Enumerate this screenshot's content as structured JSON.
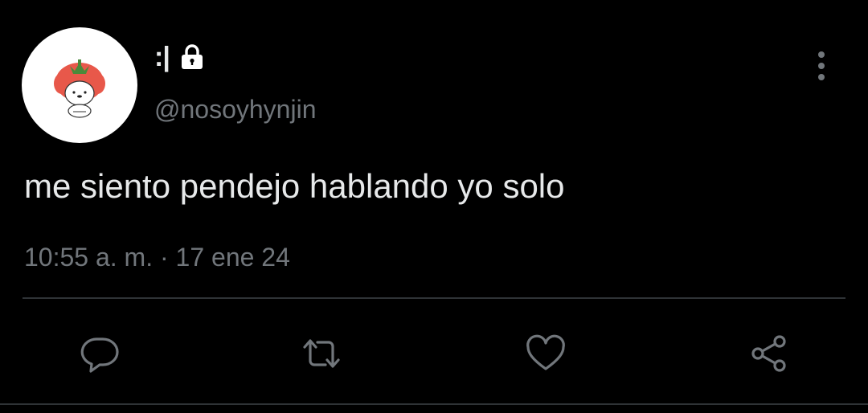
{
  "tweet": {
    "display_name": ":|",
    "handle": "@nosoyhynjin",
    "text": "me siento pendejo hablando yo solo",
    "time": "10:55 a. m.",
    "separator": "·",
    "date": "17 ene 24"
  },
  "icons": {
    "lock": "lock-icon",
    "more": "more-vertical-icon",
    "reply": "reply-icon",
    "retweet": "retweet-icon",
    "like": "heart-icon",
    "share": "share-icon"
  },
  "colors": {
    "background": "#000000",
    "text": "#e7e9ea",
    "secondary": "#71767b",
    "divider": "#2f3336"
  }
}
